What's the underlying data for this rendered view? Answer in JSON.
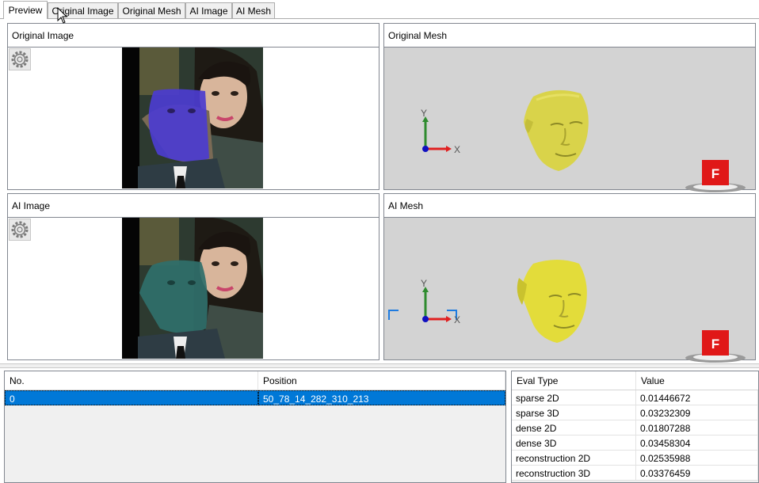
{
  "tabs": [
    {
      "label": "Preview",
      "active": true
    },
    {
      "label": "Original Image",
      "active": false
    },
    {
      "label": "Original Mesh",
      "active": false
    },
    {
      "label": "AI Image",
      "active": false
    },
    {
      "label": "AI Mesh",
      "active": false
    }
  ],
  "panels": {
    "original_image": {
      "title": "Original Image"
    },
    "original_mesh": {
      "title": "Original Mesh"
    },
    "ai_image": {
      "title": "AI Image"
    },
    "ai_mesh": {
      "title": "AI Mesh"
    }
  },
  "axis_labels": {
    "y": "Y",
    "x": "X"
  },
  "orientation_marker": "F",
  "colors": {
    "axis_y": "#2e8b2e",
    "axis_x": "#e02020",
    "axis_z": "#1010c0",
    "original_face_overlay": "#4b3ccf",
    "ai_face_overlay": "#2f6f6a",
    "mesh_original": "#d9d34a",
    "mesh_ai": "#e3dc3a",
    "marker": "#e01818",
    "selection": "#0078d7"
  },
  "results_table": {
    "columns": [
      "No.",
      "Position"
    ],
    "rows": [
      {
        "no": "0",
        "position": "50_78_14_282_310_213",
        "selected": true
      }
    ]
  },
  "eval_table": {
    "columns": [
      "Eval Type",
      "Value"
    ],
    "rows": [
      {
        "type": "sparse 2D",
        "value": "0.01446672"
      },
      {
        "type": "sparse 3D",
        "value": "0.03232309"
      },
      {
        "type": "dense 2D",
        "value": "0.01807288"
      },
      {
        "type": "dense 3D",
        "value": "0.03458304"
      },
      {
        "type": "reconstruction 2D",
        "value": "0.02535988"
      },
      {
        "type": "reconstruction 3D",
        "value": "0.03376459"
      }
    ]
  }
}
